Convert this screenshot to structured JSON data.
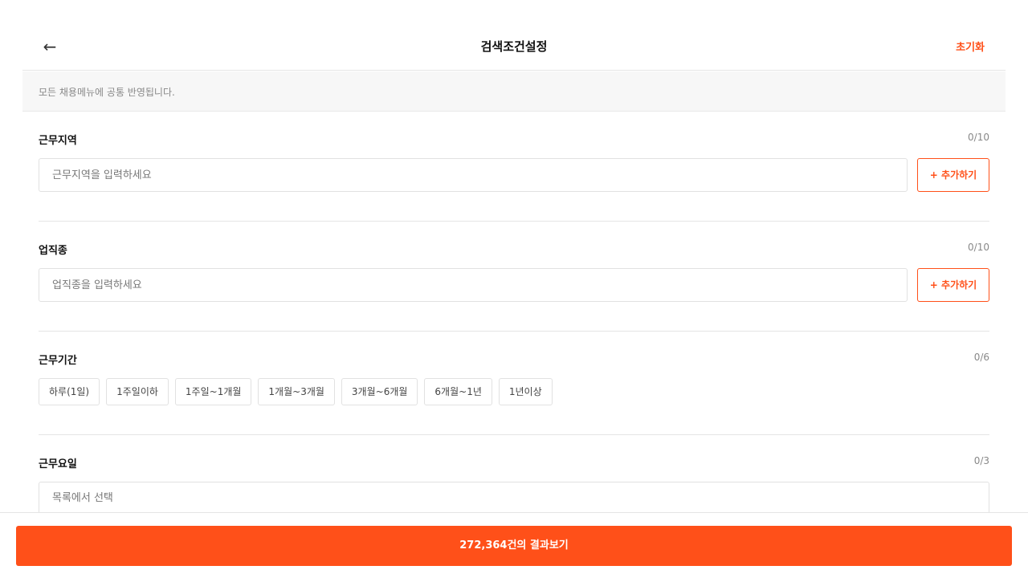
{
  "header": {
    "back_icon": "←",
    "title": "검색조건설정",
    "reset_label": "초기화"
  },
  "notice": {
    "text": "모든 채용메뉴에 공통 반영됩니다."
  },
  "sections": {
    "region": {
      "title": "근무지역",
      "count": "0/10",
      "placeholder": "근무지역을 입력하세요",
      "add_label": "+ 추가하기"
    },
    "job": {
      "title": "업직종",
      "count": "0/10",
      "placeholder": "업직종을 입력하세요",
      "add_label": "+ 추가하기"
    },
    "period": {
      "title": "근무기간",
      "count": "0/6",
      "options": [
        "하루(1일)",
        "1주일이하",
        "1주일~1개월",
        "1개월~3개월",
        "3개월~6개월",
        "6개월~1년",
        "1년이상"
      ]
    },
    "weekday": {
      "title": "근무요일",
      "count": "0/3",
      "placeholder": "목록에서 선택"
    }
  },
  "footer": {
    "result_label": "272,364건의 결과보기"
  },
  "colors": {
    "accent": "#ff5019"
  }
}
